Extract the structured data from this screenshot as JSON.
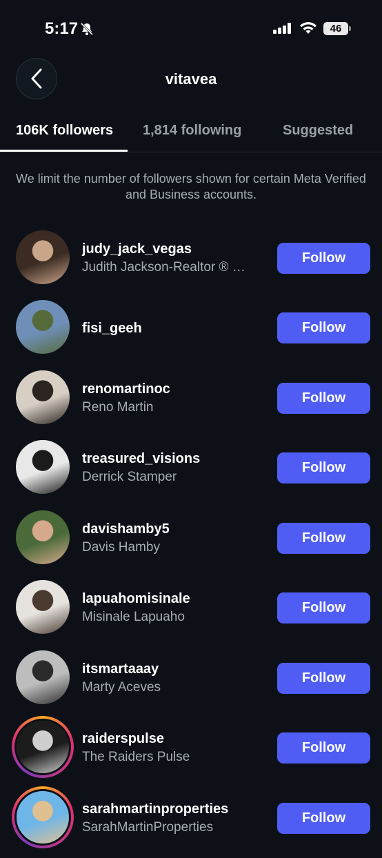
{
  "status_bar": {
    "time": "5:17",
    "battery": "46"
  },
  "header": {
    "title": "vitavea"
  },
  "tabs": [
    {
      "label": "106K followers",
      "active": true
    },
    {
      "label": "1,814 following",
      "active": false
    },
    {
      "label": "Suggested",
      "active": false
    }
  ],
  "notice": "We limit the number of followers shown for certain Meta Verified and Business accounts.",
  "follow_label": "Follow",
  "users": [
    {
      "username": "judy_jack_vegas",
      "fullname": "Judith Jackson-Realtor ® …",
      "avatar_colors": [
        "#3b2b22",
        "#c9a58a"
      ]
    },
    {
      "username": "fisi_geeh",
      "fullname": "",
      "avatar_colors": [
        "#6f8fb8",
        "#556b3a"
      ]
    },
    {
      "username": "renomartinoc",
      "fullname": "Reno Martin",
      "avatar_colors": [
        "#d8cfc4",
        "#2a2521"
      ]
    },
    {
      "username": "treasured_visions",
      "fullname": "Derrick Stamper",
      "avatar_colors": [
        "#e8e8e8",
        "#1b1b1b"
      ]
    },
    {
      "username": "davishamby5",
      "fullname": "Davis Hamby",
      "avatar_colors": [
        "#4a6a3a",
        "#d7a98c"
      ]
    },
    {
      "username": "lapuahomisinale",
      "fullname": "Misinale Lapuaho",
      "avatar_colors": [
        "#e6e3df",
        "#4a3a30"
      ]
    },
    {
      "username": "itsmartaaay",
      "fullname": "Marty Aceves",
      "avatar_colors": [
        "#bdbdbd",
        "#2b2b2b"
      ]
    },
    {
      "username": "raiderspulse",
      "fullname": "The Raiders Pulse",
      "avatar_colors": [
        "#1c1c1c",
        "#cfcfcf"
      ],
      "ring": true
    },
    {
      "username": "sarahmartinproperties",
      "fullname": "SarahMartinProperties",
      "avatar_colors": [
        "#6fb6e8",
        "#e0c090"
      ],
      "ring": true
    }
  ]
}
